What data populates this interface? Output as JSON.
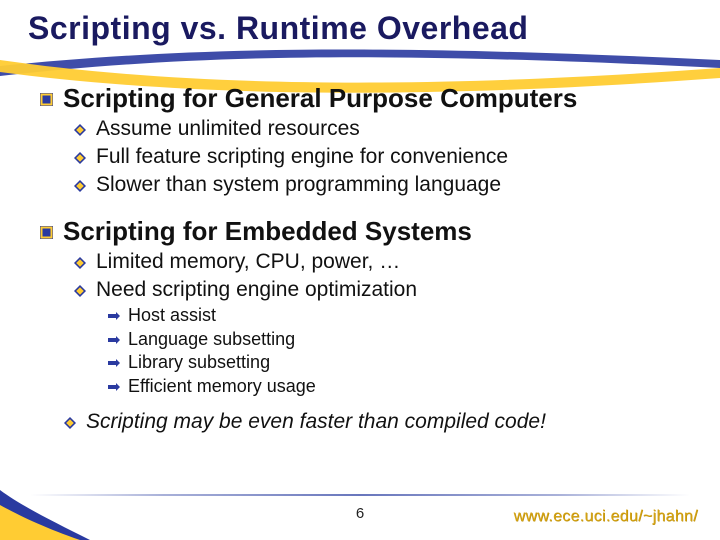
{
  "title": "Scripting vs. Runtime Overhead",
  "sections": [
    {
      "heading": "Scripting for General Purpose Computers",
      "points": [
        {
          "text": "Assume unlimited resources"
        },
        {
          "text": "Full feature scripting engine for convenience"
        },
        {
          "text": "Slower than system programming language"
        }
      ]
    },
    {
      "heading": "Scripting for Embedded Systems",
      "points": [
        {
          "text": "Limited memory, CPU, power, …"
        },
        {
          "text": "Need scripting engine optimization",
          "sub": [
            "Host assist",
            "Language subsetting",
            "Library subsetting",
            "Efficient memory usage"
          ]
        }
      ]
    }
  ],
  "closing": "Scripting may be even faster than compiled code!",
  "page_number": "6",
  "footer_url": "www.ece.uci.edu/~jhahn/"
}
